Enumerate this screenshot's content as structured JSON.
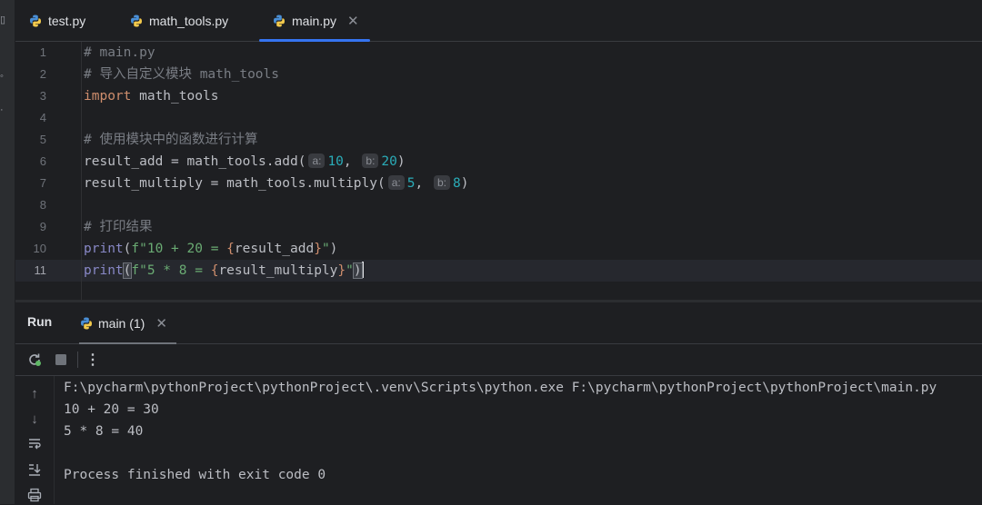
{
  "tabs": [
    {
      "label": "test.py",
      "active": false
    },
    {
      "label": "math_tools.py",
      "active": false
    },
    {
      "label": "main.py",
      "active": true
    }
  ],
  "editor": {
    "line_numbers": [
      "1",
      "2",
      "3",
      "4",
      "5",
      "6",
      "7",
      "8",
      "9",
      "10",
      "11"
    ],
    "current_line": "11",
    "lines": {
      "l1": "# main.py",
      "l2": "# 导入自定义模块 math_tools",
      "l3_kw": "import",
      "l3_rest": " math_tools",
      "l5": "# 使用模块中的函数进行计算",
      "l6_a": "result_add = math_tools.add(",
      "l6_hint_a": "a:",
      "l6_num_a": "10",
      "l6_comma": ", ",
      "l6_hint_b": "b:",
      "l6_num_b": "20",
      "l6_end": ")",
      "l7_a": "result_multiply = math_tools.multiply(",
      "l7_hint_a": "a:",
      "l7_num_a": "5",
      "l7_comma": ", ",
      "l7_hint_b": "b:",
      "l7_num_b": "8",
      "l7_end": ")",
      "l9": "# 打印结果",
      "l10_fn": "print",
      "l10_open": "(",
      "l10_str1": "f\"10 + 20 = ",
      "l10_br1": "{",
      "l10_var": "result_add",
      "l10_br2": "}",
      "l10_str2": "\"",
      "l10_close": ")",
      "l11_fn": "print",
      "l11_open": "(",
      "l11_str1": "f\"5 * 8 = ",
      "l11_br1": "{",
      "l11_var": "result_multiply",
      "l11_br2": "}",
      "l11_str2": "\"",
      "l11_close": ")"
    }
  },
  "run_panel": {
    "title": "Run",
    "tab_label": "main (1)",
    "console": [
      "F:\\pycharm\\pythonProject\\pythonProject\\.venv\\Scripts\\python.exe F:\\pycharm\\pythonProject\\pythonProject\\main.py",
      "10 + 20 = 30",
      "5 * 8 = 40",
      "",
      "Process finished with exit code 0"
    ]
  },
  "icons": {
    "python": "python-file-icon",
    "close": "close-icon",
    "rerun": "rerun-icon",
    "stop": "stop-icon",
    "more": "more-vertical-icon",
    "up": "arrow-up-icon",
    "down": "arrow-down-icon",
    "wrap": "soft-wrap-icon",
    "scroll": "scroll-to-end-icon",
    "print": "print-icon"
  },
  "colors": {
    "accent": "#3574f0",
    "comment": "#7a7e85",
    "keyword": "#cf8e6d",
    "number": "#2aacb8",
    "string": "#6aab73"
  }
}
